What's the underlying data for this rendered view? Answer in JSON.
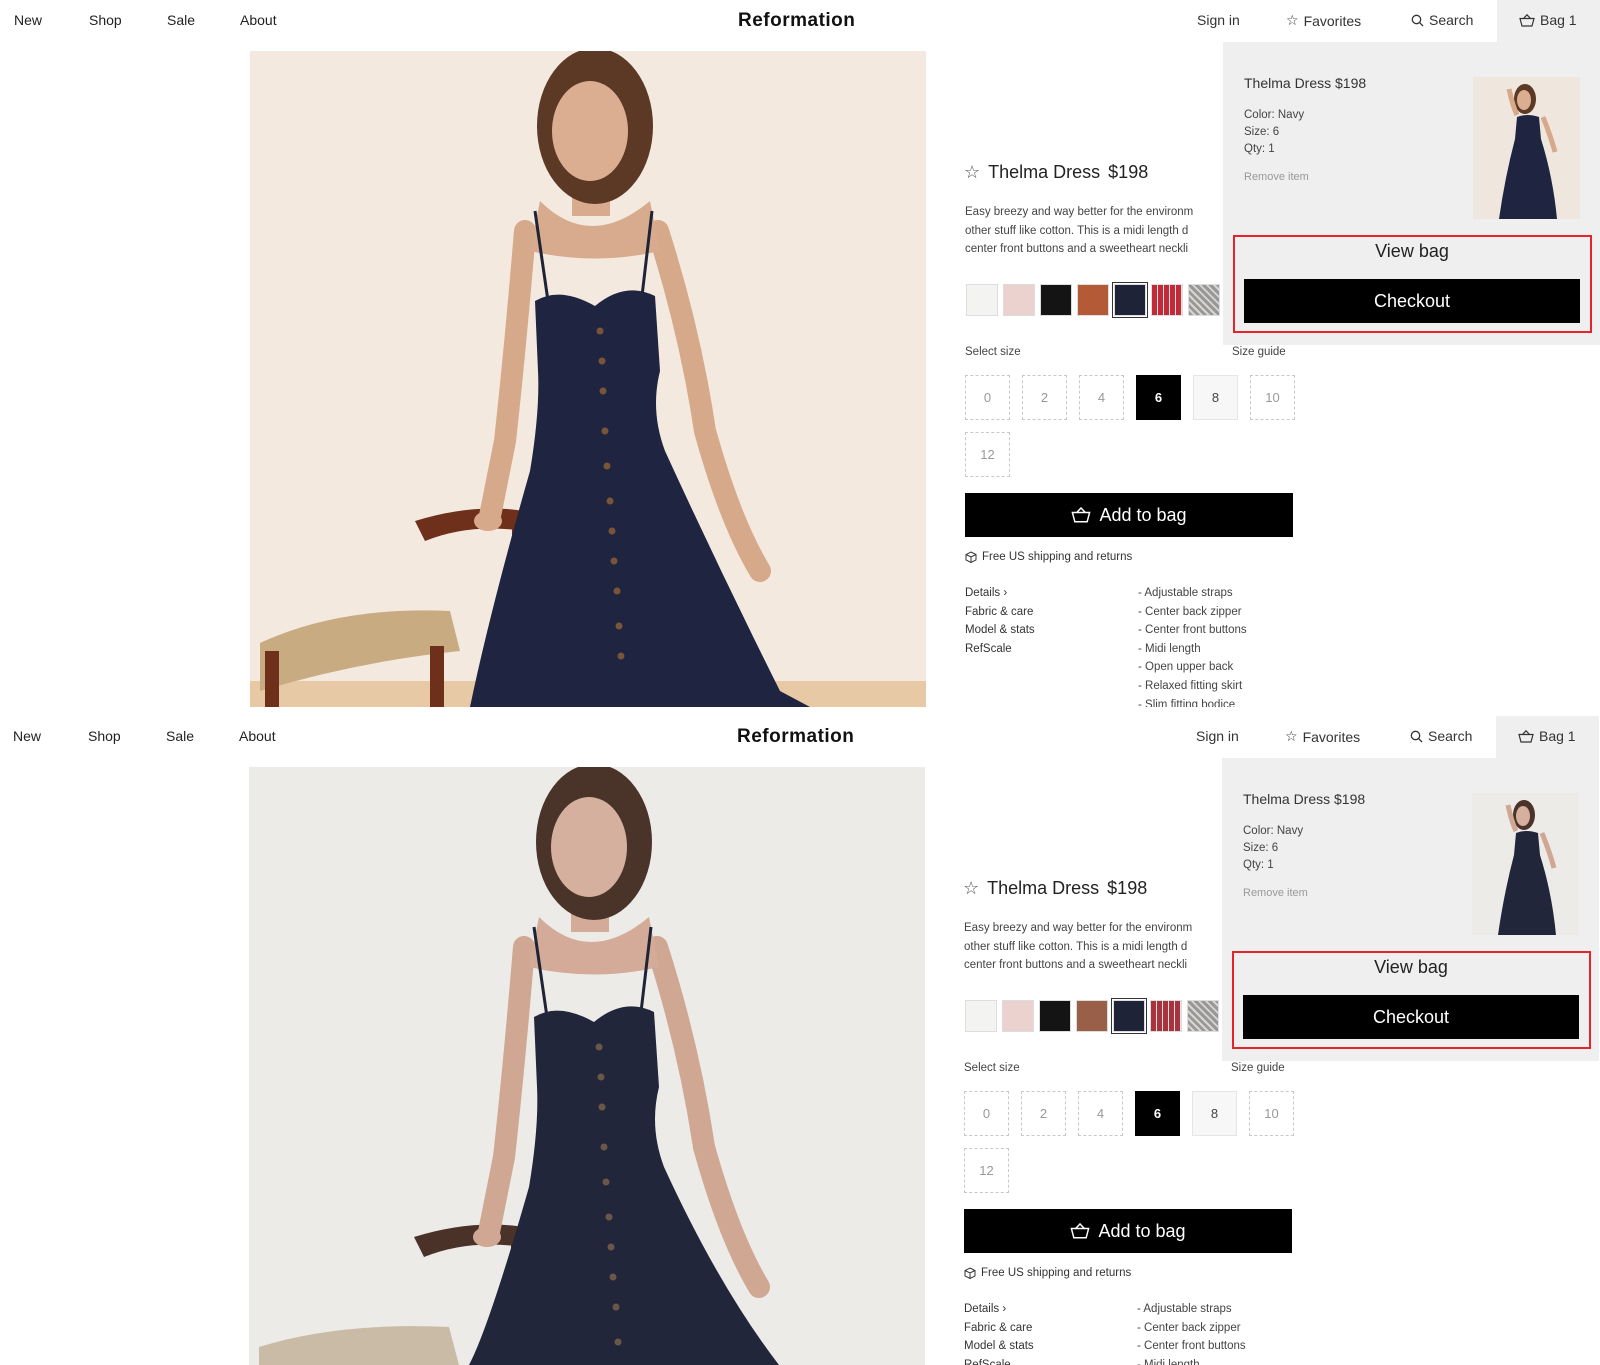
{
  "nav": {
    "left": [
      "New",
      "Shop",
      "Sale",
      "About"
    ],
    "brand": "Reformation",
    "sign_in": "Sign in",
    "favorites": "Favorites",
    "search": "Search",
    "bag": "Bag 1"
  },
  "product": {
    "name": "Thelma Dress",
    "price": "$198",
    "description": [
      "Easy breezy and way better for the environm",
      "other stuff like cotton. This is a midi length d",
      "center front buttons and a sweetheart neckli"
    ],
    "swatches": [
      {
        "name": "white",
        "color": "#f3f3f1"
      },
      {
        "name": "blush",
        "color": "#ecd2cf"
      },
      {
        "name": "black",
        "color": "#141414"
      },
      {
        "name": "rust",
        "color": "#b55a36"
      },
      {
        "name": "navy",
        "color": "#1f2337",
        "selected": true
      },
      {
        "name": "red-plaid",
        "color": "#c22a3a"
      },
      {
        "name": "grey-plaid",
        "color": "#9a9896"
      }
    ],
    "select_size_label": "Select size",
    "size_guide_label": "Size guide",
    "sizes": [
      "0",
      "2",
      "4",
      "6",
      "8",
      "10",
      "12"
    ],
    "selected_size": "6",
    "add_to_bag": "Add to bag",
    "shipping": "Free US shipping and returns",
    "detail_links": [
      "Details",
      "Fabric & care",
      "Model & stats",
      "RefScale"
    ],
    "features": [
      "- Adjustable straps",
      "- Center back zipper",
      "- Center front buttons",
      "- Midi length",
      "- Open upper back",
      "- Relaxed fitting skirt",
      "- Slim fitting bodice"
    ]
  },
  "minibag": {
    "title": "Thelma Dress $198",
    "color": "Color: Navy",
    "size": "Size: 6",
    "qty": "Qty: 1",
    "remove": "Remove item",
    "view_bag": "View bag",
    "checkout": "Checkout",
    "highlight_color": "#e4242a"
  }
}
